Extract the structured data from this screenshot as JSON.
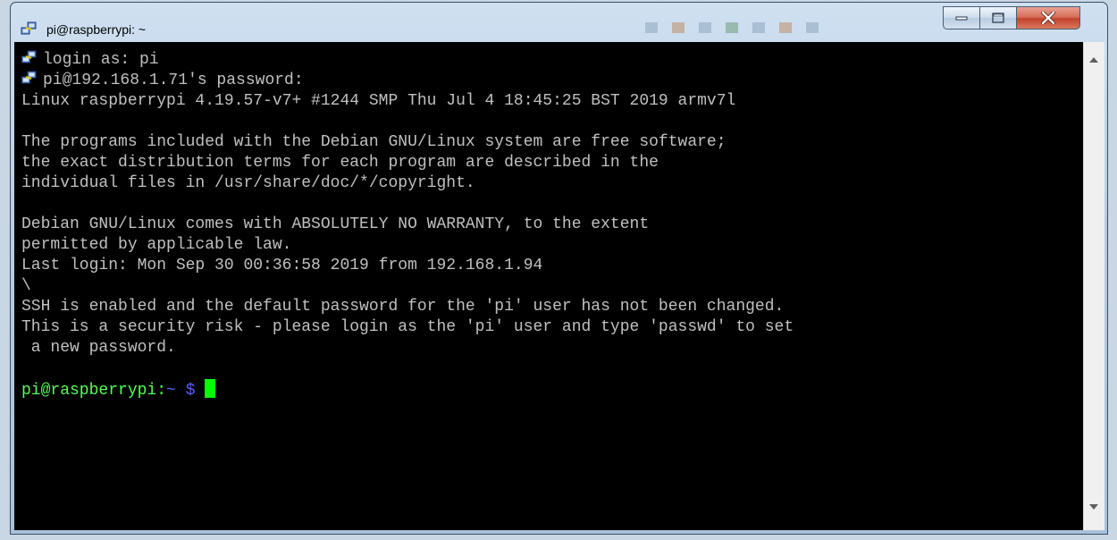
{
  "window": {
    "title": "pi@raspberrypi: ~",
    "buttons": {
      "minimize": "minimize",
      "maximize": "maximize",
      "close": "close"
    }
  },
  "terminal": {
    "lines": [
      {
        "text": "login as: pi",
        "icon": "putty-icon"
      },
      {
        "text": "pi@192.168.1.71's password:",
        "icon": "putty-icon"
      },
      {
        "text": "Linux raspberrypi 4.19.57-v7+ #1244 SMP Thu Jul 4 18:45:25 BST 2019 armv7l"
      },
      {
        "text": ""
      },
      {
        "text": "The programs included with the Debian GNU/Linux system are free software;"
      },
      {
        "text": "the exact distribution terms for each program are described in the"
      },
      {
        "text": "individual files in /usr/share/doc/*/copyright."
      },
      {
        "text": ""
      },
      {
        "text": "Debian GNU/Linux comes with ABSOLUTELY NO WARRANTY, to the extent"
      },
      {
        "text": "permitted by applicable law."
      },
      {
        "text": "Last login: Mon Sep 30 00:36:58 2019 from 192.168.1.94"
      },
      {
        "text": "\\"
      },
      {
        "text": "SSH is enabled and the default password for the 'pi' user has not been changed."
      },
      {
        "text": "This is a security risk - please login as the 'pi' user and type 'passwd' to set"
      },
      {
        "text": " a new password."
      },
      {
        "text": ""
      }
    ],
    "prompt": {
      "user": "pi@raspberrypi:",
      "path": "~",
      "symbol": "$"
    },
    "colors": {
      "background": "#000000",
      "text": "#c0c0c0",
      "prompt_user": "#54ff54",
      "prompt_symbol": "#5c5cff",
      "cursor": "#00ff00"
    }
  }
}
